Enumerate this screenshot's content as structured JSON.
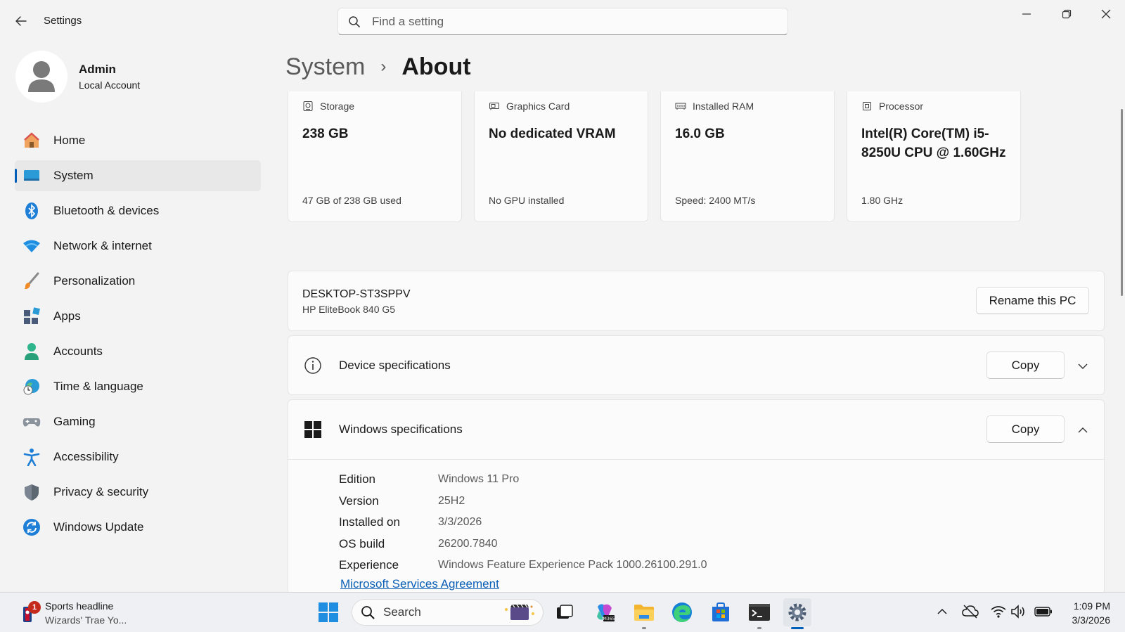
{
  "window": {
    "title": "Settings"
  },
  "search": {
    "placeholder": "Find a setting"
  },
  "profile": {
    "name": "Admin",
    "account_type": "Local Account"
  },
  "nav": {
    "items": [
      {
        "label": "Home",
        "icon": "home-icon"
      },
      {
        "label": "System",
        "icon": "system-icon",
        "active": true
      },
      {
        "label": "Bluetooth & devices",
        "icon": "bluetooth-icon"
      },
      {
        "label": "Network & internet",
        "icon": "wifi-icon"
      },
      {
        "label": "Personalization",
        "icon": "brush-icon"
      },
      {
        "label": "Apps",
        "icon": "apps-icon"
      },
      {
        "label": "Accounts",
        "icon": "accounts-icon"
      },
      {
        "label": "Time & language",
        "icon": "time-language-icon"
      },
      {
        "label": "Gaming",
        "icon": "gamepad-icon"
      },
      {
        "label": "Accessibility",
        "icon": "accessibility-icon"
      },
      {
        "label": "Privacy & security",
        "icon": "shield-icon"
      },
      {
        "label": "Windows Update",
        "icon": "update-icon"
      }
    ]
  },
  "breadcrumb": {
    "parent": "System",
    "current": "About"
  },
  "spec_cards": [
    {
      "label": "Storage",
      "value": "238 GB",
      "sub": "47 GB of 238 GB used",
      "icon": "storage-icon"
    },
    {
      "label": "Graphics Card",
      "value": "No dedicated VRAM",
      "sub": "No GPU installed",
      "icon": "graphics-card-icon"
    },
    {
      "label": "Installed RAM",
      "value": "16.0 GB",
      "sub": "Speed: 2400 MT/s",
      "icon": "ram-icon"
    },
    {
      "label": "Processor",
      "value": "Intel(R) Core(TM) i5-8250U CPU @ 1.60GHz",
      "sub": "1.80 GHz",
      "icon": "processor-icon"
    }
  ],
  "device": {
    "name": "DESKTOP-ST3SPPV",
    "model": "HP EliteBook 840 G5",
    "rename_label": "Rename this PC"
  },
  "device_specs": {
    "title": "Device specifications",
    "copy_label": "Copy",
    "expanded": false
  },
  "windows_specs": {
    "title": "Windows specifications",
    "copy_label": "Copy",
    "expanded": true,
    "rows": [
      {
        "key": "Edition",
        "value": "Windows 11 Pro"
      },
      {
        "key": "Version",
        "value": "25H2"
      },
      {
        "key": "Installed on",
        "value": "3/3/2026"
      },
      {
        "key": "OS build",
        "value": "26200.7840"
      },
      {
        "key": "Experience",
        "value": "Windows Feature Experience Pack 1000.26100.291.0"
      }
    ],
    "link": "Microsoft Services Agreement"
  },
  "taskbar": {
    "widget": {
      "badge": "1",
      "title": "Sports headline",
      "subtitle": "Wizards' Trae Yo..."
    },
    "search_label": "Search",
    "clock": {
      "time": "1:09 PM",
      "date": "3/3/2026"
    }
  },
  "colors": {
    "accent": "#005fb8",
    "link": "#0a5fb4",
    "background": "#f3f3f3",
    "card": "#fbfbfb"
  }
}
